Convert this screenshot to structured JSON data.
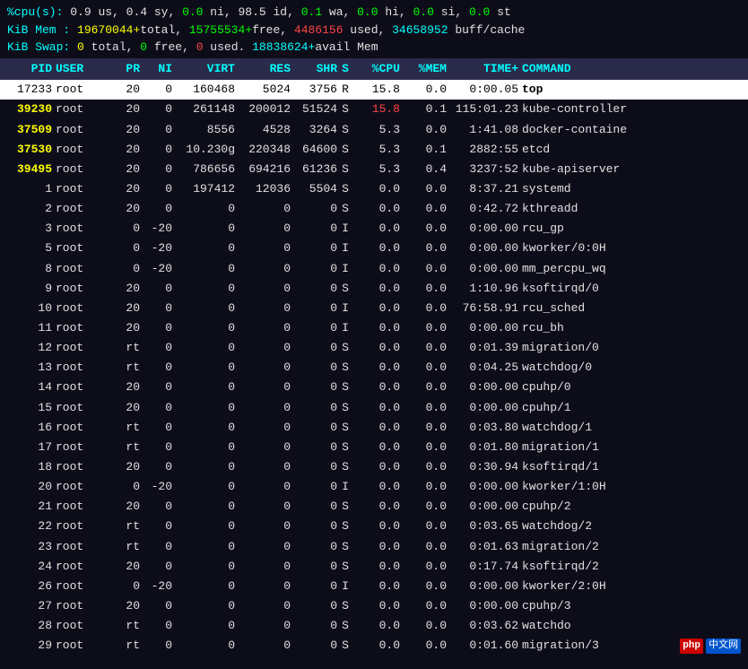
{
  "header": {
    "cpu_line": "%cpu(s):  0.9 us,  0.4 sy,  0.0 ni, 98.5 id,  0.1 wa,  0.0 hi,  0.0 si,  0.0 st",
    "mem_line": "KiB Mem : 19670044+total, 15755534+free,  4486156 used, 34658952 buff/cache",
    "swap_line": "KiB Swap:        0 total,        0 free,        0 used. 18838624+avail Mem"
  },
  "columns": [
    "PID",
    "USER",
    "PR",
    "NI",
    "VIRT",
    "RES",
    "SHR",
    "S",
    "%CPU",
    "%MEM",
    "TIME+",
    "COMMAND"
  ],
  "processes": [
    {
      "pid": "17233",
      "user": "root",
      "pr": "20",
      "ni": "0",
      "virt": "160468",
      "res": "5024",
      "shr": "3756",
      "s": "R",
      "cpu": "15.8",
      "mem": "0.0",
      "time": "0:00.05",
      "cmd": "top",
      "highlight": true
    },
    {
      "pid": "39230",
      "user": "root",
      "pr": "20",
      "ni": "0",
      "virt": "261148",
      "res": "200012",
      "shr": "51524",
      "s": "S",
      "cpu": "15.8",
      "mem": "0.1",
      "time": "115:01.23",
      "cmd": "kube-controller"
    },
    {
      "pid": "37509",
      "user": "root",
      "pr": "20",
      "ni": "0",
      "virt": "8556",
      "res": "4528",
      "shr": "3264",
      "s": "S",
      "cpu": "5.3",
      "mem": "0.0",
      "time": "1:41.08",
      "cmd": "docker-containe"
    },
    {
      "pid": "37530",
      "user": "root",
      "pr": "20",
      "ni": "0",
      "virt": "10.230g",
      "res": "220348",
      "shr": "64600",
      "s": "S",
      "cpu": "5.3",
      "mem": "0.1",
      "time": "2882:55",
      "cmd": "etcd"
    },
    {
      "pid": "39495",
      "user": "root",
      "pr": "20",
      "ni": "0",
      "virt": "786656",
      "res": "694216",
      "shr": "61236",
      "s": "S",
      "cpu": "5.3",
      "mem": "0.4",
      "time": "3237:52",
      "cmd": "kube-apiserver"
    },
    {
      "pid": "1",
      "user": "root",
      "pr": "20",
      "ni": "0",
      "virt": "197412",
      "res": "12036",
      "shr": "5504",
      "s": "S",
      "cpu": "0.0",
      "mem": "0.0",
      "time": "8:37.21",
      "cmd": "systemd"
    },
    {
      "pid": "2",
      "user": "root",
      "pr": "20",
      "ni": "0",
      "virt": "0",
      "res": "0",
      "shr": "0",
      "s": "S",
      "cpu": "0.0",
      "mem": "0.0",
      "time": "0:42.72",
      "cmd": "kthreadd"
    },
    {
      "pid": "3",
      "user": "root",
      "pr": "0",
      "ni": "-20",
      "virt": "0",
      "res": "0",
      "shr": "0",
      "s": "I",
      "cpu": "0.0",
      "mem": "0.0",
      "time": "0:00.00",
      "cmd": "rcu_gp"
    },
    {
      "pid": "5",
      "user": "root",
      "pr": "0",
      "ni": "-20",
      "virt": "0",
      "res": "0",
      "shr": "0",
      "s": "I",
      "cpu": "0.0",
      "mem": "0.0",
      "time": "0:00.00",
      "cmd": "kworker/0:0H"
    },
    {
      "pid": "8",
      "user": "root",
      "pr": "0",
      "ni": "-20",
      "virt": "0",
      "res": "0",
      "shr": "0",
      "s": "I",
      "cpu": "0.0",
      "mem": "0.0",
      "time": "0:00.00",
      "cmd": "mm_percpu_wq"
    },
    {
      "pid": "9",
      "user": "root",
      "pr": "20",
      "ni": "0",
      "virt": "0",
      "res": "0",
      "shr": "0",
      "s": "S",
      "cpu": "0.0",
      "mem": "0.0",
      "time": "1:10.96",
      "cmd": "ksoftirqd/0"
    },
    {
      "pid": "10",
      "user": "root",
      "pr": "20",
      "ni": "0",
      "virt": "0",
      "res": "0",
      "shr": "0",
      "s": "I",
      "cpu": "0.0",
      "mem": "0.0",
      "time": "76:58.91",
      "cmd": "rcu_sched"
    },
    {
      "pid": "11",
      "user": "root",
      "pr": "20",
      "ni": "0",
      "virt": "0",
      "res": "0",
      "shr": "0",
      "s": "I",
      "cpu": "0.0",
      "mem": "0.0",
      "time": "0:00.00",
      "cmd": "rcu_bh"
    },
    {
      "pid": "12",
      "user": "root",
      "pr": "rt",
      "ni": "0",
      "virt": "0",
      "res": "0",
      "shr": "0",
      "s": "S",
      "cpu": "0.0",
      "mem": "0.0",
      "time": "0:01.39",
      "cmd": "migration/0"
    },
    {
      "pid": "13",
      "user": "root",
      "pr": "rt",
      "ni": "0",
      "virt": "0",
      "res": "0",
      "shr": "0",
      "s": "S",
      "cpu": "0.0",
      "mem": "0.0",
      "time": "0:04.25",
      "cmd": "watchdog/0"
    },
    {
      "pid": "14",
      "user": "root",
      "pr": "20",
      "ni": "0",
      "virt": "0",
      "res": "0",
      "shr": "0",
      "s": "S",
      "cpu": "0.0",
      "mem": "0.0",
      "time": "0:00.00",
      "cmd": "cpuhp/0"
    },
    {
      "pid": "15",
      "user": "root",
      "pr": "20",
      "ni": "0",
      "virt": "0",
      "res": "0",
      "shr": "0",
      "s": "S",
      "cpu": "0.0",
      "mem": "0.0",
      "time": "0:00.00",
      "cmd": "cpuhp/1"
    },
    {
      "pid": "16",
      "user": "root",
      "pr": "rt",
      "ni": "0",
      "virt": "0",
      "res": "0",
      "shr": "0",
      "s": "S",
      "cpu": "0.0",
      "mem": "0.0",
      "time": "0:03.80",
      "cmd": "watchdog/1"
    },
    {
      "pid": "17",
      "user": "root",
      "pr": "rt",
      "ni": "0",
      "virt": "0",
      "res": "0",
      "shr": "0",
      "s": "S",
      "cpu": "0.0",
      "mem": "0.0",
      "time": "0:01.80",
      "cmd": "migration/1"
    },
    {
      "pid": "18",
      "user": "root",
      "pr": "20",
      "ni": "0",
      "virt": "0",
      "res": "0",
      "shr": "0",
      "s": "S",
      "cpu": "0.0",
      "mem": "0.0",
      "time": "0:30.94",
      "cmd": "ksoftirqd/1"
    },
    {
      "pid": "20",
      "user": "root",
      "pr": "0",
      "ni": "-20",
      "virt": "0",
      "res": "0",
      "shr": "0",
      "s": "I",
      "cpu": "0.0",
      "mem": "0.0",
      "time": "0:00.00",
      "cmd": "kworker/1:0H"
    },
    {
      "pid": "21",
      "user": "root",
      "pr": "20",
      "ni": "0",
      "virt": "0",
      "res": "0",
      "shr": "0",
      "s": "S",
      "cpu": "0.0",
      "mem": "0.0",
      "time": "0:00.00",
      "cmd": "cpuhp/2"
    },
    {
      "pid": "22",
      "user": "root",
      "pr": "rt",
      "ni": "0",
      "virt": "0",
      "res": "0",
      "shr": "0",
      "s": "S",
      "cpu": "0.0",
      "mem": "0.0",
      "time": "0:03.65",
      "cmd": "watchdog/2"
    },
    {
      "pid": "23",
      "user": "root",
      "pr": "rt",
      "ni": "0",
      "virt": "0",
      "res": "0",
      "shr": "0",
      "s": "S",
      "cpu": "0.0",
      "mem": "0.0",
      "time": "0:01.63",
      "cmd": "migration/2"
    },
    {
      "pid": "24",
      "user": "root",
      "pr": "20",
      "ni": "0",
      "virt": "0",
      "res": "0",
      "shr": "0",
      "s": "S",
      "cpu": "0.0",
      "mem": "0.0",
      "time": "0:17.74",
      "cmd": "ksoftirqd/2"
    },
    {
      "pid": "26",
      "user": "root",
      "pr": "0",
      "ni": "-20",
      "virt": "0",
      "res": "0",
      "shr": "0",
      "s": "I",
      "cpu": "0.0",
      "mem": "0.0",
      "time": "0:00.00",
      "cmd": "kworker/2:0H"
    },
    {
      "pid": "27",
      "user": "root",
      "pr": "20",
      "ni": "0",
      "virt": "0",
      "res": "0",
      "shr": "0",
      "s": "S",
      "cpu": "0.0",
      "mem": "0.0",
      "time": "0:00.00",
      "cmd": "cpuhp/3"
    },
    {
      "pid": "28",
      "user": "root",
      "pr": "rt",
      "ni": "0",
      "virt": "0",
      "res": "0",
      "shr": "0",
      "s": "S",
      "cpu": "0.0",
      "mem": "0.0",
      "time": "0:03.62",
      "cmd": "watchdo"
    },
    {
      "pid": "29",
      "user": "root",
      "pr": "rt",
      "ni": "0",
      "virt": "0",
      "res": "0",
      "shr": "0",
      "s": "S",
      "cpu": "0.0",
      "mem": "0.0",
      "time": "0:01.60",
      "cmd": "migration/3"
    }
  ],
  "badges": {
    "php_label": "php",
    "site_label": "中文网"
  }
}
